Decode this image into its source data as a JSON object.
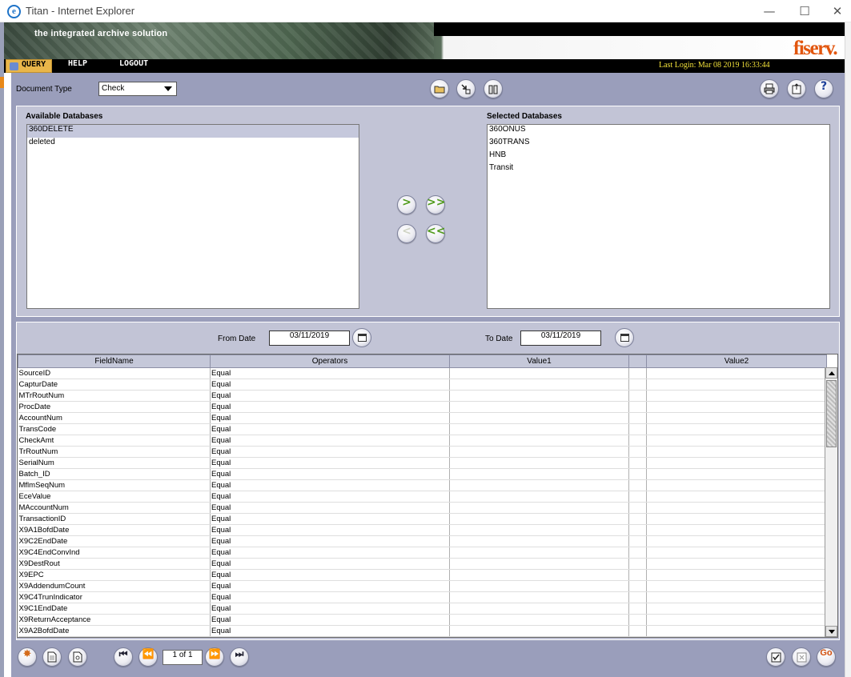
{
  "window": {
    "title": "Titan - Internet Explorer",
    "minimize": "—",
    "maximize": "☐",
    "close": "✕"
  },
  "banner": {
    "tagline": "the integrated archive solution",
    "logo": "fiserv."
  },
  "menu": {
    "items": [
      "Query",
      "HELP",
      "LOGOUT"
    ],
    "last_login": "Last Login: Mar 08 2019 16:33:44"
  },
  "toolbar": {
    "document_type_label": "Document Type",
    "document_type_value": "Check"
  },
  "databases": {
    "available_title": "Available Databases",
    "available": [
      "360DELETE",
      "deleted"
    ],
    "selected_title": "Selected Databases",
    "selected": [
      "360ONUS",
      "360TRANS",
      "HNB",
      "Transit"
    ],
    "move_right": ">",
    "move_all_right": ">>",
    "move_left": "<",
    "move_all_left": "<<"
  },
  "dates": {
    "from_label": "From Date",
    "from_value": "03/11/2019",
    "to_label": "To Date",
    "to_value": "03/11/2019"
  },
  "grid": {
    "columns": [
      "FieldName",
      "Operators",
      "Value1",
      "",
      "Value2"
    ],
    "rows": [
      {
        "field": "SourceID",
        "operator": "Equal"
      },
      {
        "field": "CapturDate",
        "operator": "Equal"
      },
      {
        "field": "MTrRoutNum",
        "operator": "Equal"
      },
      {
        "field": "ProcDate",
        "operator": "Equal"
      },
      {
        "field": "AccountNum",
        "operator": "Equal"
      },
      {
        "field": "TransCode",
        "operator": "Equal"
      },
      {
        "field": "CheckAmt",
        "operator": "Equal"
      },
      {
        "field": "TrRoutNum",
        "operator": "Equal"
      },
      {
        "field": "SerialNum",
        "operator": "Equal"
      },
      {
        "field": "Batch_ID",
        "operator": "Equal"
      },
      {
        "field": "MflmSeqNum",
        "operator": "Equal"
      },
      {
        "field": "EceValue",
        "operator": "Equal"
      },
      {
        "field": "MAccountNum",
        "operator": "Equal"
      },
      {
        "field": "TransactionID",
        "operator": "Equal"
      },
      {
        "field": "X9A1BofdDate",
        "operator": "Equal"
      },
      {
        "field": "X9C2EndDate",
        "operator": "Equal"
      },
      {
        "field": "X9C4EndConvInd",
        "operator": "Equal"
      },
      {
        "field": "X9DestRout",
        "operator": "Equal"
      },
      {
        "field": "X9EPC",
        "operator": "Equal"
      },
      {
        "field": "X9AddendumCount",
        "operator": "Equal"
      },
      {
        "field": "X9C4TrunIndicator",
        "operator": "Equal"
      },
      {
        "field": "X9C1EndDate",
        "operator": "Equal"
      },
      {
        "field": "X9ReturnAcceptance",
        "operator": "Equal"
      },
      {
        "field": "X9A2BofdDate",
        "operator": "Equal"
      }
    ]
  },
  "pager": {
    "text": "1 of 1"
  },
  "actions": {
    "go": "Go",
    "help": "?"
  }
}
